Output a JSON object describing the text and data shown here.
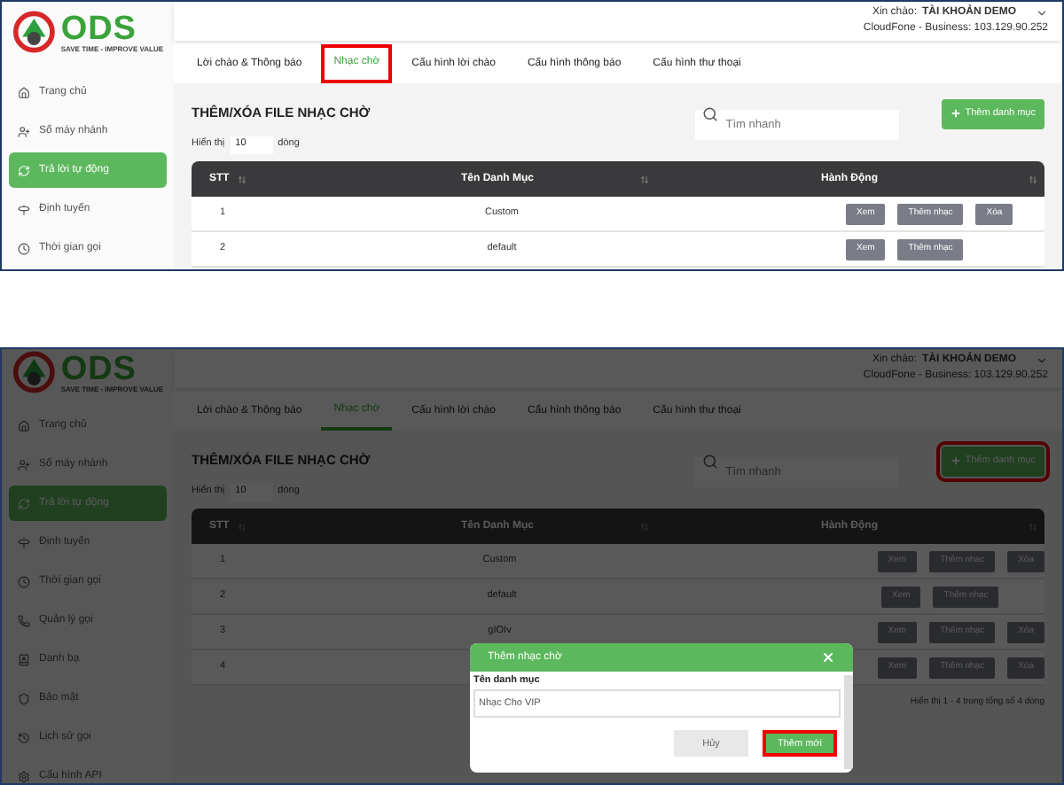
{
  "screens": [
    {
      "logo": {
        "name": "ODS",
        "tagline": "SAVE TIME - IMPROVE VALUE"
      },
      "header": {
        "greeting": "Xin chào:",
        "account": "TÀI KHOẢN DEMO",
        "server": "CloudFone - Business: 103.129.90.252"
      },
      "sidebar": [
        {
          "label": "Trang chủ",
          "selected": false
        },
        {
          "label": "Số máy nhánh",
          "selected": false
        },
        {
          "label": "Trả lời tự động",
          "selected": true
        },
        {
          "label": "Định tuyến",
          "selected": false
        },
        {
          "label": "Thời gian gọi",
          "selected": false
        }
      ],
      "tabs": [
        {
          "label": "Lời chào & Thông báo",
          "selected": false,
          "highlighted": false
        },
        {
          "label": "Nhạc chờ",
          "selected": true,
          "highlighted": true
        },
        {
          "label": "Cấu hình lời chào",
          "selected": false,
          "highlighted": false
        },
        {
          "label": "Cấu hình thông báo",
          "selected": false,
          "highlighted": false
        },
        {
          "label": "Cấu hình thư thoại",
          "selected": false,
          "highlighted": false
        }
      ],
      "title": "THÊM/XÓA FILE NHẠC CHỜ",
      "search": {
        "placeholder": "Tìm nhanh"
      },
      "add_button": {
        "label": "Thêm danh mục",
        "highlighted": false
      },
      "page_size": {
        "prefix": "Hiển thị",
        "value": "10",
        "suffix": "dòng"
      },
      "table": {
        "columns": [
          "STT",
          "Tên Danh Mục",
          "Hành Động"
        ],
        "rows": [
          {
            "stt": "1",
            "name": "Custom",
            "actions": [
              "Xem",
              "Thêm nhạc",
              "Xóa"
            ]
          },
          {
            "stt": "2",
            "name": "default",
            "actions": [
              "Xem",
              "Thêm nhạc"
            ]
          }
        ]
      }
    },
    {
      "logo": {
        "name": "ODS",
        "tagline": "SAVE TIME - IMPROVE VALUE"
      },
      "header": {
        "greeting": "Xin chào:",
        "account": "TÀI KHOẢN DEMO",
        "server": "CloudFone - Business: 103.129.90.252"
      },
      "sidebar": [
        {
          "label": "Trang chủ",
          "selected": false
        },
        {
          "label": "Số máy nhánh",
          "selected": false
        },
        {
          "label": "Trả lời tự động",
          "selected": true
        },
        {
          "label": "Định tuyến",
          "selected": false
        },
        {
          "label": "Thời gian gọi",
          "selected": false
        },
        {
          "label": "Quản lý gọi",
          "selected": false
        },
        {
          "label": "Danh bạ",
          "selected": false
        },
        {
          "label": "Bảo mật",
          "selected": false
        },
        {
          "label": "Lịch sử gọi",
          "selected": false
        },
        {
          "label": "Cấu hình API",
          "selected": false
        }
      ],
      "tabs": [
        {
          "label": "Lời chào & Thông báo",
          "selected": false,
          "highlighted": false
        },
        {
          "label": "Nhạc chờ",
          "selected": true,
          "highlighted": false
        },
        {
          "label": "Cấu hình lời chào",
          "selected": false,
          "highlighted": false
        },
        {
          "label": "Cấu hình thông báo",
          "selected": false,
          "highlighted": false
        },
        {
          "label": "Cấu hình thư thoại",
          "selected": false,
          "highlighted": false
        }
      ],
      "title": "THÊM/XÓA FILE NHẠC CHỜ",
      "search": {
        "placeholder": "Tìm nhanh"
      },
      "add_button": {
        "label": "Thêm danh mục",
        "highlighted": true
      },
      "page_size": {
        "prefix": "Hiển thị",
        "value": "10",
        "suffix": "dòng"
      },
      "table": {
        "columns": [
          "STT",
          "Tên Danh Mục",
          "Hành Động"
        ],
        "rows": [
          {
            "stt": "1",
            "name": "Custom",
            "actions": [
              "Xem",
              "Thêm nhạc",
              "Xóa"
            ]
          },
          {
            "stt": "2",
            "name": "default",
            "actions": [
              "Xem",
              "Thêm nhạc"
            ]
          },
          {
            "stt": "3",
            "name": "gIOIv",
            "actions": [
              "Xem",
              "Thêm nhạc",
              "Xóa"
            ]
          },
          {
            "stt": "4",
            "actions": [
              "Xem",
              "Thêm nhạc",
              "Xóa"
            ]
          }
        ]
      },
      "footer": "Hiển thị 1 - 4 trong tổng số 4 dòng",
      "modal": {
        "title": "Thêm nhạc chờ",
        "field_label": "Tên danh mục",
        "value": "Nhạc Cho VIP",
        "buttons": [
          {
            "label": "Hủy",
            "kind": "cancel",
            "highlighted": false
          },
          {
            "label": "Thêm mới",
            "kind": "primary",
            "highlighted": true
          }
        ]
      }
    }
  ]
}
